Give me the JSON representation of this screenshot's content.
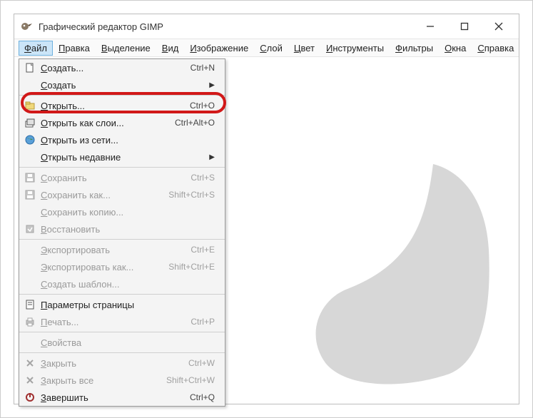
{
  "window": {
    "title": "Графический редактор GIMP"
  },
  "menubar": {
    "items": [
      "Файл",
      "Правка",
      "Выделение",
      "Вид",
      "Изображение",
      "Слой",
      "Цвет",
      "Инструменты",
      "Фильтры",
      "Окна",
      "Справка"
    ],
    "active_index": 0
  },
  "dropdown": {
    "groups": [
      [
        {
          "icon": "new-file-icon",
          "label": "Создать...",
          "shortcut": "Ctrl+N",
          "enabled": true
        },
        {
          "icon": "",
          "label": "Создать",
          "submenu": true,
          "enabled": true
        }
      ],
      [
        {
          "icon": "folder-icon",
          "label": "Открыть...",
          "shortcut": "Ctrl+O",
          "enabled": true,
          "highlighted": true
        },
        {
          "icon": "layers-icon",
          "label": "Открыть как слои...",
          "shortcut": "Ctrl+Alt+O",
          "enabled": true
        },
        {
          "icon": "globe-icon",
          "label": "Открыть из сети...",
          "enabled": true
        },
        {
          "icon": "",
          "label": "Открыть недавние",
          "submenu": true,
          "enabled": true
        }
      ],
      [
        {
          "icon": "save-icon",
          "label": "Сохранить",
          "shortcut": "Ctrl+S",
          "enabled": false
        },
        {
          "icon": "save-as-icon",
          "label": "Сохранить как...",
          "shortcut": "Shift+Ctrl+S",
          "enabled": false
        },
        {
          "icon": "",
          "label": "Сохранить копию...",
          "enabled": false
        },
        {
          "icon": "revert-icon",
          "label": "Восстановить",
          "enabled": false
        }
      ],
      [
        {
          "icon": "",
          "label": "Экспортировать",
          "shortcut": "Ctrl+E",
          "enabled": false
        },
        {
          "icon": "",
          "label": "Экспортировать как...",
          "shortcut": "Shift+Ctrl+E",
          "enabled": false
        },
        {
          "icon": "",
          "label": "Создать шаблон...",
          "enabled": false
        }
      ],
      [
        {
          "icon": "page-setup-icon",
          "label": "Параметры страницы",
          "enabled": true
        },
        {
          "icon": "print-icon",
          "label": "Печать...",
          "shortcut": "Ctrl+P",
          "enabled": false
        }
      ],
      [
        {
          "icon": "",
          "label": "Свойства",
          "enabled": false
        }
      ],
      [
        {
          "icon": "close-icon",
          "label": "Закрыть",
          "shortcut": "Ctrl+W",
          "enabled": false
        },
        {
          "icon": "close-all-icon",
          "label": "Закрыть все",
          "shortcut": "Shift+Ctrl+W",
          "enabled": false
        },
        {
          "icon": "quit-icon",
          "label": "Завершить",
          "shortcut": "Ctrl+Q",
          "enabled": true
        }
      ]
    ]
  }
}
